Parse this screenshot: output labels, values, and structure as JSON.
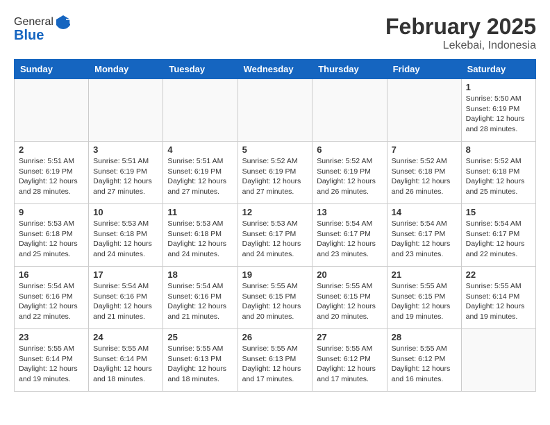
{
  "logo": {
    "general": "General",
    "blue": "Blue"
  },
  "header": {
    "month": "February 2025",
    "location": "Lekebai, Indonesia"
  },
  "weekdays": [
    "Sunday",
    "Monday",
    "Tuesday",
    "Wednesday",
    "Thursday",
    "Friday",
    "Saturday"
  ],
  "weeks": [
    [
      {
        "day": "",
        "info": ""
      },
      {
        "day": "",
        "info": ""
      },
      {
        "day": "",
        "info": ""
      },
      {
        "day": "",
        "info": ""
      },
      {
        "day": "",
        "info": ""
      },
      {
        "day": "",
        "info": ""
      },
      {
        "day": "1",
        "info": "Sunrise: 5:50 AM\nSunset: 6:19 PM\nDaylight: 12 hours and 28 minutes."
      }
    ],
    [
      {
        "day": "2",
        "info": "Sunrise: 5:51 AM\nSunset: 6:19 PM\nDaylight: 12 hours and 28 minutes."
      },
      {
        "day": "3",
        "info": "Sunrise: 5:51 AM\nSunset: 6:19 PM\nDaylight: 12 hours and 27 minutes."
      },
      {
        "day": "4",
        "info": "Sunrise: 5:51 AM\nSunset: 6:19 PM\nDaylight: 12 hours and 27 minutes."
      },
      {
        "day": "5",
        "info": "Sunrise: 5:52 AM\nSunset: 6:19 PM\nDaylight: 12 hours and 27 minutes."
      },
      {
        "day": "6",
        "info": "Sunrise: 5:52 AM\nSunset: 6:19 PM\nDaylight: 12 hours and 26 minutes."
      },
      {
        "day": "7",
        "info": "Sunrise: 5:52 AM\nSunset: 6:18 PM\nDaylight: 12 hours and 26 minutes."
      },
      {
        "day": "8",
        "info": "Sunrise: 5:52 AM\nSunset: 6:18 PM\nDaylight: 12 hours and 25 minutes."
      }
    ],
    [
      {
        "day": "9",
        "info": "Sunrise: 5:53 AM\nSunset: 6:18 PM\nDaylight: 12 hours and 25 minutes."
      },
      {
        "day": "10",
        "info": "Sunrise: 5:53 AM\nSunset: 6:18 PM\nDaylight: 12 hours and 24 minutes."
      },
      {
        "day": "11",
        "info": "Sunrise: 5:53 AM\nSunset: 6:18 PM\nDaylight: 12 hours and 24 minutes."
      },
      {
        "day": "12",
        "info": "Sunrise: 5:53 AM\nSunset: 6:17 PM\nDaylight: 12 hours and 24 minutes."
      },
      {
        "day": "13",
        "info": "Sunrise: 5:54 AM\nSunset: 6:17 PM\nDaylight: 12 hours and 23 minutes."
      },
      {
        "day": "14",
        "info": "Sunrise: 5:54 AM\nSunset: 6:17 PM\nDaylight: 12 hours and 23 minutes."
      },
      {
        "day": "15",
        "info": "Sunrise: 5:54 AM\nSunset: 6:17 PM\nDaylight: 12 hours and 22 minutes."
      }
    ],
    [
      {
        "day": "16",
        "info": "Sunrise: 5:54 AM\nSunset: 6:16 PM\nDaylight: 12 hours and 22 minutes."
      },
      {
        "day": "17",
        "info": "Sunrise: 5:54 AM\nSunset: 6:16 PM\nDaylight: 12 hours and 21 minutes."
      },
      {
        "day": "18",
        "info": "Sunrise: 5:54 AM\nSunset: 6:16 PM\nDaylight: 12 hours and 21 minutes."
      },
      {
        "day": "19",
        "info": "Sunrise: 5:55 AM\nSunset: 6:15 PM\nDaylight: 12 hours and 20 minutes."
      },
      {
        "day": "20",
        "info": "Sunrise: 5:55 AM\nSunset: 6:15 PM\nDaylight: 12 hours and 20 minutes."
      },
      {
        "day": "21",
        "info": "Sunrise: 5:55 AM\nSunset: 6:15 PM\nDaylight: 12 hours and 19 minutes."
      },
      {
        "day": "22",
        "info": "Sunrise: 5:55 AM\nSunset: 6:14 PM\nDaylight: 12 hours and 19 minutes."
      }
    ],
    [
      {
        "day": "23",
        "info": "Sunrise: 5:55 AM\nSunset: 6:14 PM\nDaylight: 12 hours and 19 minutes."
      },
      {
        "day": "24",
        "info": "Sunrise: 5:55 AM\nSunset: 6:14 PM\nDaylight: 12 hours and 18 minutes."
      },
      {
        "day": "25",
        "info": "Sunrise: 5:55 AM\nSunset: 6:13 PM\nDaylight: 12 hours and 18 minutes."
      },
      {
        "day": "26",
        "info": "Sunrise: 5:55 AM\nSunset: 6:13 PM\nDaylight: 12 hours and 17 minutes."
      },
      {
        "day": "27",
        "info": "Sunrise: 5:55 AM\nSunset: 6:12 PM\nDaylight: 12 hours and 17 minutes."
      },
      {
        "day": "28",
        "info": "Sunrise: 5:55 AM\nSunset: 6:12 PM\nDaylight: 12 hours and 16 minutes."
      },
      {
        "day": "",
        "info": ""
      }
    ]
  ]
}
